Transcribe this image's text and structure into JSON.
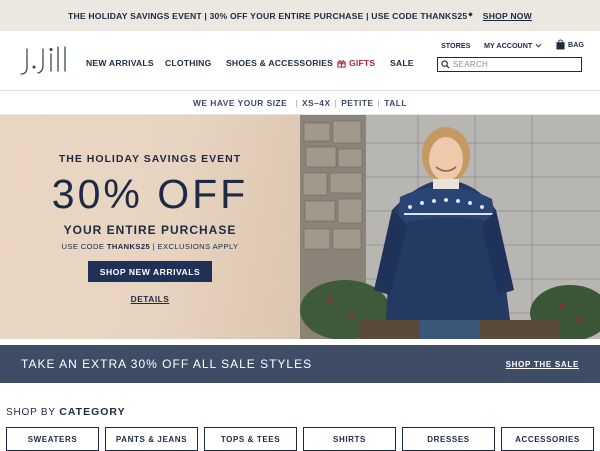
{
  "promo": {
    "text": "THE HOLIDAY SAVINGS EVENT | 30% OFF YOUR ENTIRE PURCHASE | USE CODE THANKS25",
    "marker": "⬥",
    "link": "SHOP NOW"
  },
  "header": {
    "logo_text": "J.JILL",
    "nav": [
      "NEW ARRIVALS",
      "CLOTHING",
      "SHOES & ACCESSORIES",
      "GIFTS",
      "SALE"
    ],
    "utility": {
      "stores": "STORES",
      "account": "MY ACCOUNT",
      "bag": "BAG"
    },
    "search_placeholder": "SEARCH"
  },
  "sizes": {
    "label": "WE HAVE YOUR SIZE",
    "options": [
      "XS–4X",
      "PETITE",
      "TALL"
    ]
  },
  "hero": {
    "eyebrow": "THE HOLIDAY SAVINGS EVENT",
    "headline": "30% OFF",
    "subhead": "YOUR ENTIRE PURCHASE",
    "code_prefix": "USE CODE",
    "code": "THANKS25",
    "code_suffix": "| EXCLUSIONS APPLY",
    "button": "SHOP NEW ARRIVALS",
    "details": "DETAILS"
  },
  "sale_banner": {
    "text": "TAKE AN EXTRA 30% OFF ALL SALE STYLES",
    "link": "SHOP THE SALE"
  },
  "categories": {
    "prefix": "SHOP BY",
    "title": "CATEGORY",
    "items": [
      "SWEATERS",
      "PANTS & JEANS",
      "TOPS & TEES",
      "SHIRTS",
      "DRESSES",
      "ACCESSORIES"
    ]
  },
  "colors": {
    "navy": "#1d2a44",
    "button_navy": "#1f3159",
    "banner_slate": "#3e4c66",
    "gifts_red": "#b3232e",
    "promo_bg": "#ece7e1"
  }
}
